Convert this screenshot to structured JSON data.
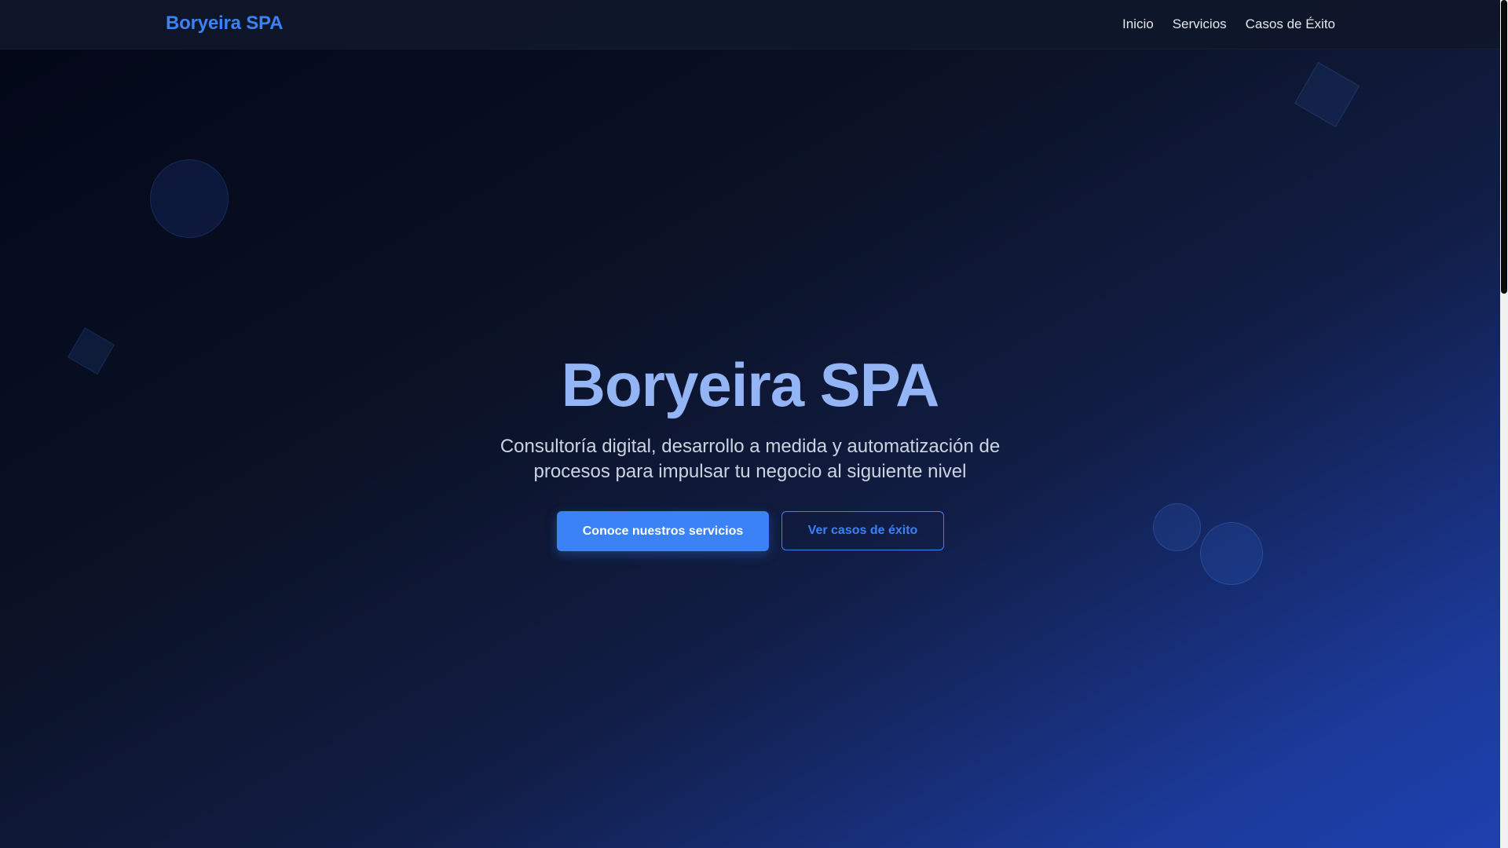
{
  "header": {
    "brand": "Boryeira SPA",
    "nav": [
      {
        "label": "Inicio"
      },
      {
        "label": "Servicios"
      },
      {
        "label": "Casos de Éxito"
      }
    ]
  },
  "hero": {
    "title": "Boryeira SPA",
    "subtitle": "Consultoría digital, desarrollo a medida y automatización de procesos para impulsar tu negocio al siguiente nivel",
    "primary_button": "Conoce nuestros servicios",
    "secondary_button": "Ver casos de éxito"
  },
  "colors": {
    "accent": "#3b82f6",
    "title": "#93b4f5",
    "background_start": "#020617",
    "background_end": "#1e40af"
  }
}
